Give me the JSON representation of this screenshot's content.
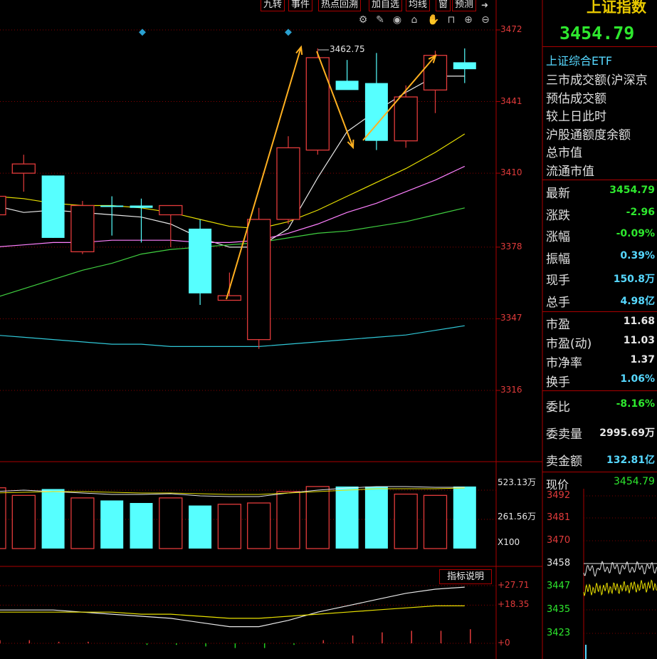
{
  "toolbar": {
    "tabs": [
      "九转",
      "事件",
      "热点回溯",
      "加自选",
      "均线",
      "窗",
      "预测"
    ]
  },
  "tool_icons": [
    "gear-icon",
    "pen-icon",
    "eye-icon",
    "lock-open-icon",
    "hand-icon",
    "lock-icon",
    "zoom-in-icon",
    "zoom-out-icon"
  ],
  "colors": {
    "up": "#e23b3b",
    "down": "#56ffff",
    "ma5": "#e8e8e8",
    "ma10": "#e8e000",
    "ma20": "#ff80ff",
    "ma30": "#40d040",
    "ma60": "#30c8d8",
    "arrow": "#ffb020",
    "green_text": "#2ee82e",
    "cyan_text": "#56d8ff"
  },
  "chart_data": [
    {
      "type": "candlestick",
      "yticks": [
        3472,
        3441,
        3410,
        3378,
        3347,
        3316
      ],
      "ylim": [
        3285,
        3485
      ],
      "max_annotation": "3462.75",
      "candles": [
        {
          "o": 3400,
          "h": 3404,
          "l": 3394,
          "c": 3392,
          "dir": "up"
        },
        {
          "o": 3414,
          "h": 3418,
          "l": 3402,
          "c": 3410,
          "dir": "up"
        },
        {
          "o": 3409,
          "h": 3409,
          "l": 3382,
          "c": 3382,
          "dir": "down"
        },
        {
          "o": 3376,
          "h": 3398,
          "l": 3375,
          "c": 3396,
          "dir": "up"
        },
        {
          "o": 3396,
          "h": 3400,
          "l": 3383,
          "c": 3396,
          "dir": "down"
        },
        {
          "o": 3396,
          "h": 3399,
          "l": 3380,
          "c": 3395,
          "dir": "down"
        },
        {
          "o": 3392,
          "h": 3396,
          "l": 3378,
          "c": 3396,
          "dir": "up"
        },
        {
          "o": 3386,
          "h": 3390,
          "l": 3353,
          "c": 3358,
          "dir": "down"
        },
        {
          "o": 3357,
          "h": 3367,
          "l": 3355,
          "c": 3355,
          "dir": "up"
        },
        {
          "o": 3338,
          "h": 3395,
          "l": 3334,
          "c": 3390,
          "dir": "up"
        },
        {
          "o": 3390,
          "h": 3426,
          "l": 3388,
          "c": 3421,
          "dir": "up"
        },
        {
          "o": 3420,
          "h": 3464,
          "l": 3418,
          "c": 3460,
          "dir": "up"
        },
        {
          "o": 3450,
          "h": 3459,
          "l": 3448,
          "c": 3446,
          "dir": "down"
        },
        {
          "o": 3449,
          "h": 3462,
          "l": 3420,
          "c": 3424,
          "dir": "down"
        },
        {
          "o": 3424,
          "h": 3448,
          "l": 3421,
          "c": 3443,
          "dir": "up"
        },
        {
          "o": 3446,
          "h": 3463,
          "l": 3436,
          "c": 3461,
          "dir": "up"
        },
        {
          "o": 3458,
          "h": 3464,
          "l": 3449,
          "c": 3455,
          "dir": "down"
        }
      ],
      "ma": {
        "ma5": [
          3396,
          3393,
          3394,
          3393,
          3392,
          3391,
          3388,
          3382,
          3378,
          3378,
          3386,
          3408,
          3428,
          3437,
          3445,
          3452,
          3452
        ],
        "ma10": [
          3400,
          3399,
          3397,
          3396,
          3396,
          3395,
          3393,
          3390,
          3387,
          3386,
          3389,
          3394,
          3400,
          3406,
          3412,
          3419,
          3427
        ],
        "ma20": [
          3378,
          3379,
          3380,
          3380,
          3381,
          3381,
          3381,
          3380,
          3380,
          3381,
          3384,
          3388,
          3393,
          3397,
          3402,
          3407,
          3413
        ],
        "ma30": [
          3356,
          3360,
          3364,
          3368,
          3371,
          3375,
          3377,
          3378,
          3379,
          3380,
          3382,
          3384,
          3385,
          3387,
          3389,
          3392,
          3395
        ],
        "ma60": [
          3340,
          3339,
          3338,
          3337,
          3336,
          3336,
          3335,
          3335,
          3335,
          3335,
          3336,
          3337,
          3338,
          3339,
          3340,
          3342,
          3344
        ]
      }
    },
    {
      "type": "bar",
      "name": "volume",
      "yticks_labels": [
        "523.13万",
        "261.56万"
      ],
      "unit_label": "X100",
      "values": [
        480,
        420,
        470,
        400,
        380,
        360,
        400,
        340,
        350,
        360,
        450,
        490,
        490,
        490,
        430,
        420,
        490
      ],
      "ylim": [
        0,
        523.13
      ]
    },
    {
      "type": "line",
      "name": "indicator",
      "button": "指标说明",
      "yticks": [
        "+27.71",
        "+18.35",
        "+0"
      ],
      "dif": [
        16,
        16,
        16,
        15,
        14,
        13,
        12,
        10,
        8,
        8,
        11,
        15,
        18,
        21,
        24,
        26,
        27
      ],
      "dea": [
        15,
        15,
        15,
        15,
        15,
        14,
        14,
        13,
        12,
        12,
        13,
        14,
        15,
        16,
        17,
        18,
        18
      ],
      "macd": [
        2,
        2,
        1,
        1,
        0,
        -1,
        -1,
        -2,
        -3,
        -3,
        -1,
        2,
        5,
        7,
        8,
        8,
        9
      ]
    }
  ],
  "sidebar": {
    "index_title": "上证指数",
    "index_value": "3454.79",
    "etf_label": "上证综合ETF",
    "info_labels": [
      "三市成交额(沪深京",
      "预估成交额",
      "较上日此时",
      "沪股通额度余额",
      "总市值",
      "流通市值"
    ],
    "quotes": [
      {
        "k": "最新",
        "v": "3454.79",
        "c": "green"
      },
      {
        "k": "涨跌",
        "v": "-2.96",
        "c": "green"
      },
      {
        "k": "涨幅",
        "v": "-0.09%",
        "c": "green"
      },
      {
        "k": "振幅",
        "v": "0.39%",
        "c": "cyan"
      },
      {
        "k": "现手",
        "v": "150.8万",
        "c": "cyan"
      },
      {
        "k": "总手",
        "v": "4.98亿",
        "c": "cyan"
      }
    ],
    "valuation": [
      {
        "k": "市盈",
        "v": "11.68",
        "c": "white"
      },
      {
        "k": "市盈(动)",
        "v": "11.03",
        "c": "white"
      },
      {
        "k": "市净率",
        "v": "1.37",
        "c": "white"
      },
      {
        "k": "换手",
        "v": "1.06%",
        "c": "cyan"
      }
    ],
    "orders": [
      {
        "k": "委比",
        "v": "-8.16%",
        "c": "green"
      },
      {
        "k": "委卖量",
        "v": "2995.69万",
        "c": "white"
      },
      {
        "k": "卖金额",
        "v": "132.81亿",
        "c": "cyan"
      }
    ],
    "mini_chart": {
      "price_label": "现价",
      "price_value": "3454.79",
      "yticks": [
        "3492",
        "3481",
        "3470",
        "3458",
        "3447",
        "3435",
        "3423"
      ]
    }
  }
}
